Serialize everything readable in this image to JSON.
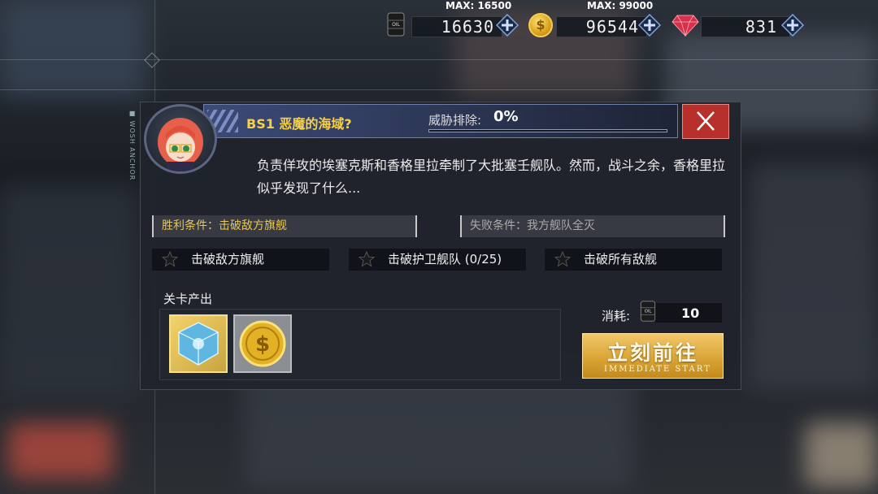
{
  "resources": {
    "oil": {
      "value": "16630",
      "max": "MAX: 16500",
      "icon": "oil-barrel-icon"
    },
    "coins": {
      "value": "96544",
      "max": "MAX: 99000",
      "icon": "gold-coin-icon"
    },
    "gems": {
      "value": "831",
      "icon": "red-gem-icon"
    }
  },
  "stage": {
    "title": "BS1  恶魔的海域?",
    "threat_label": "威胁排除:",
    "threat_value": "0%",
    "threat_fraction": 0,
    "description": "负责佯攻的埃塞克斯和香格里拉牵制了大批塞壬舰队。然而，战斗之余，香格里拉似乎发现了什么...",
    "side_text": "■ WOSH ANCHOR"
  },
  "conditions": {
    "win": "胜利条件：击破敌方旗舰",
    "lose": "失败条件：我方舰队全灭"
  },
  "objectives": [
    {
      "label": "击破敌方旗舰"
    },
    {
      "label": "击破护卫舰队 (0/25)"
    },
    {
      "label": "击破所有敌舰"
    }
  ],
  "drops": {
    "title": "关卡产出",
    "items": [
      {
        "icon": "blue-cube-icon"
      },
      {
        "icon": "gold-coin-icon"
      }
    ]
  },
  "cost": {
    "label": "消耗:",
    "value": "10",
    "icon": "oil-barrel-icon"
  },
  "start_button": {
    "label": "立刻前往",
    "sub": "IMMEDIATE START"
  },
  "colors": {
    "accent_gold": "#f5d04a",
    "close_red": "#b8302c",
    "button_gold": "#d8a233"
  }
}
